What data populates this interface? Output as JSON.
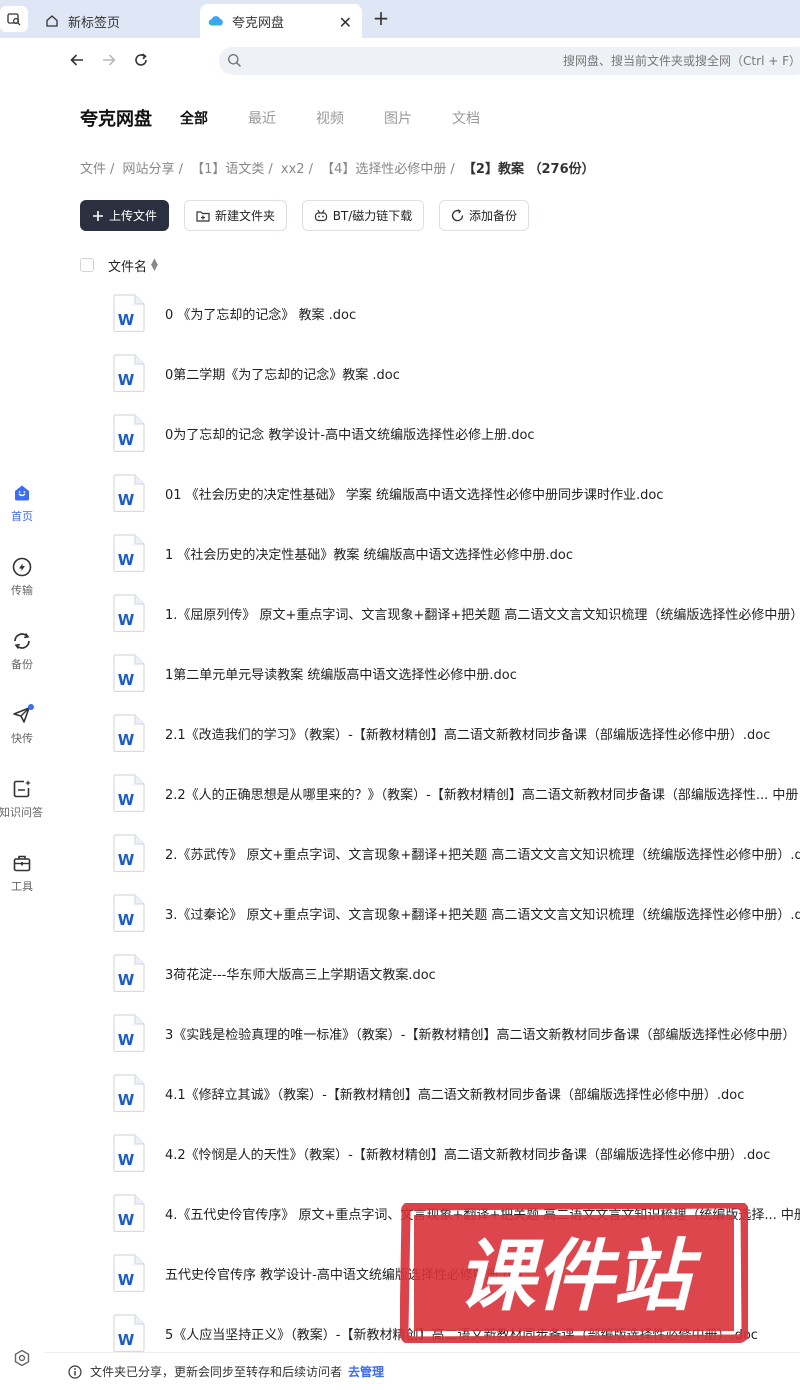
{
  "browser": {
    "tabs": [
      {
        "label": "新标签页"
      },
      {
        "label": "夸克网盘"
      }
    ],
    "address_placeholder": "搜网盘、搜当前文件夹或搜全网（Ctrl + F）"
  },
  "sidebar": {
    "items": [
      {
        "label": "首页",
        "icon": "home-icon"
      },
      {
        "label": "传输",
        "icon": "transfer-icon"
      },
      {
        "label": "备份",
        "icon": "backup-icon"
      },
      {
        "label": "快传",
        "icon": "quick-send-icon"
      },
      {
        "label": "知识问答",
        "icon": "qa-icon"
      },
      {
        "label": "工具",
        "icon": "toolbox-icon"
      }
    ]
  },
  "header": {
    "brand": "夸克网盘",
    "tabs": [
      "全部",
      "最近",
      "视频",
      "图片",
      "文档"
    ]
  },
  "breadcrumb": [
    "文件",
    "网站分享",
    "【1】语文类",
    "xx2",
    "【4】选择性必修中册"
  ],
  "breadcrumb_current": "【2】教案 （276份）",
  "toolbar": {
    "upload": "上传文件",
    "new_folder": "新建文件夹",
    "bt_download": "BT/磁力链下载",
    "add_backup": "添加备份"
  },
  "table": {
    "header": "文件名",
    "files": [
      "0 《为了忘却的记念》 教案 .doc",
      "0第二学期《为了忘却的记念》教案 .doc",
      "0为了忘却的记念 教学设计-高中语文统编版选择性必修上册.doc",
      "01 《社会历史的决定性基础》 学案    统编版高中语文选择性必修中册同步课时作业.doc",
      "1 《社会历史的决定性基础》教案  统编版高中语文选择性必修中册.doc",
      "1.《屈原列传》 原文+重点字词、文言现象+翻译+把关题  高二语文文言文知识梳理（统编版选择性必修中册）",
      "1第二单元单元导读教案 统编版高中语文选择性必修中册.doc",
      "2.1《改造我们的学习》（教案）-【新教材精创】高二语文新教材同步备课（部编版选择性必修中册）.doc",
      "2.2《人的正确思想是从哪里来的？》（教案）-【新教材精创】高二语文新教材同步备课（部编版选择性...  中册",
      "2.《苏武传》 原文+重点字词、文言现象+翻译+把关题  高二语文文言文知识梳理（统编版选择性必修中册）.do",
      "3.《过秦论》 原文+重点字词、文言现象+翻译+把关题  高二语文文言文知识梳理（统编版选择性必修中册）.do",
      "3荷花淀---华东师大版高三上学期语文教案.doc",
      "3《实践是检验真理的唯一标准》（教案）-【新教材精创】高二语文新教材同步备课（部编版选择性必修中册）",
      "4.1《修辞立其诚》（教案）-【新教材精创】高二语文新教材同步备课（部编版选择性必修中册）.doc",
      "4.2《怜悯是人的天性》（教案）-【新教材精创】高二语文新教材同步备课（部编版选择性必修中册）.doc",
      "4.《五代史伶官传序》 原文+重点字词、文言现象+翻译+把关题  高二语文文言文知识梳理（统编版选择...  中册",
      "五代史伶官传序 教学设计-高中语文统编版选择性必修中册.doc",
      "5《人应当坚持正义》（教案）-【新教材精创】高二语文新教材同步备课（部编版选择性必修中册）.doc"
    ]
  },
  "bottom": {
    "notice": "文件夹已分享，更新会同步至转存和后续访问者",
    "manage": "去管理"
  },
  "watermark": "课件站",
  "colors": {
    "accent": "#3d6cf5",
    "word_blue": "#1a5cc8",
    "primary_button": "#2b3040",
    "stamp_red": "#d9323a"
  }
}
